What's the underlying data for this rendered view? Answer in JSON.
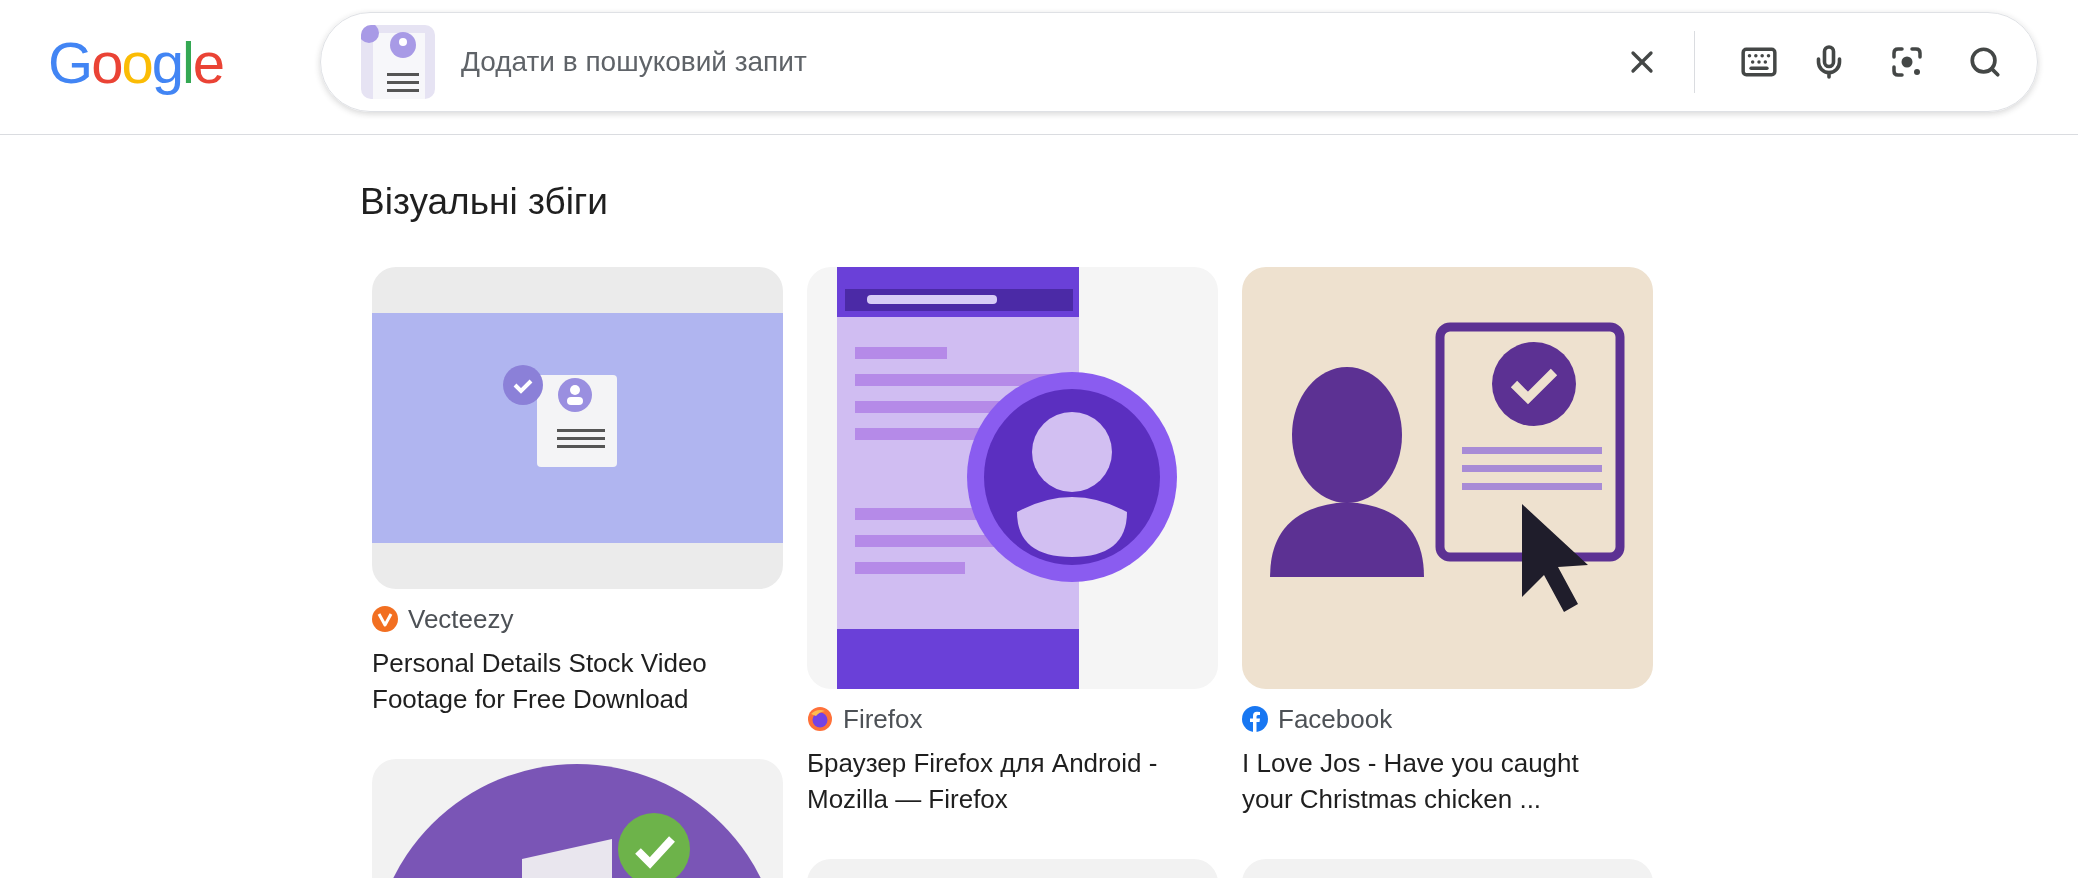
{
  "logo": "Google",
  "search": {
    "placeholder": "Додати в пошуковий запит"
  },
  "section": {
    "title": "Візуальні збіги"
  },
  "columns": [
    [
      {
        "kind": "video-still",
        "source": {
          "kind": "vecteezy",
          "name": "Vecteezy"
        },
        "title": "Personal Details Stock Video Footage for Free Download"
      },
      {
        "kind": "circle-check"
      }
    ],
    [
      {
        "kind": "browser-screen",
        "source": {
          "kind": "firefox",
          "name": "Firefox"
        },
        "title": "Браузер Firefox для Android - Mozilla — Firefox"
      },
      {
        "kind": "plain"
      }
    ],
    [
      {
        "kind": "person-check",
        "source": {
          "kind": "facebook",
          "name": "Facebook"
        },
        "title": "I Love Jos - Have you caught your Christmas chicken ..."
      },
      {
        "kind": "plain"
      }
    ]
  ]
}
